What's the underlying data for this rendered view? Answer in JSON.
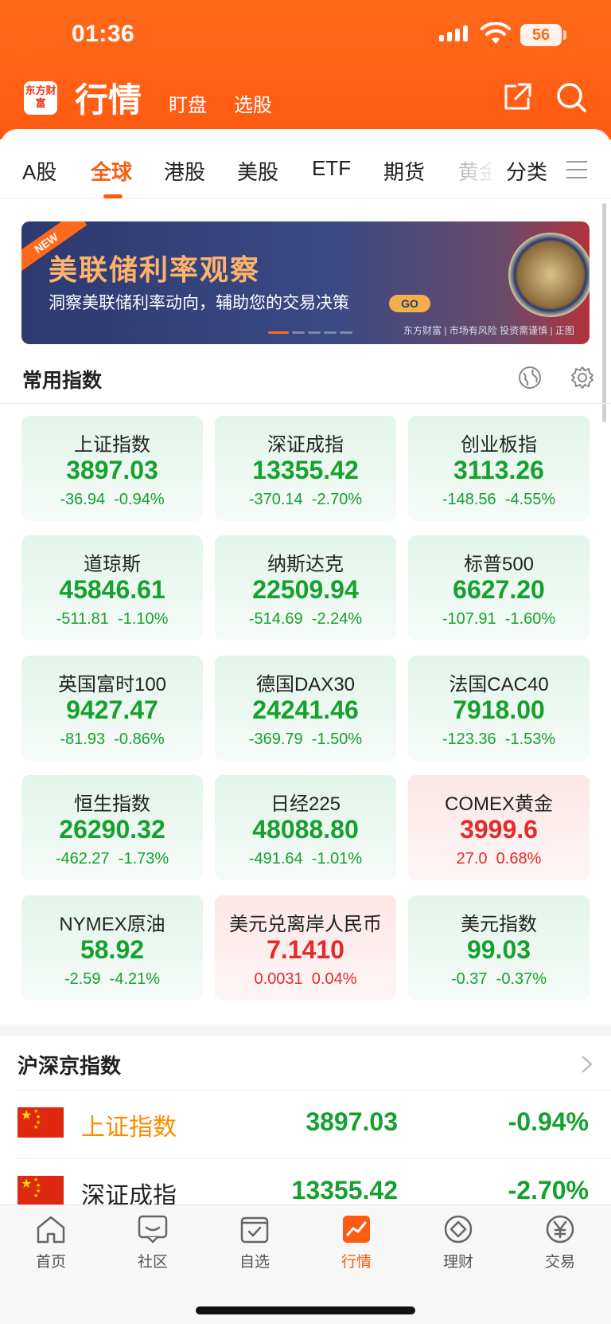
{
  "status_bar": {
    "time": "01:36",
    "battery": "56"
  },
  "header": {
    "logo": "东方财富",
    "title": "行情",
    "sub_nav": [
      "盯盘",
      "选股"
    ],
    "icons": [
      "share-icon",
      "search-icon"
    ]
  },
  "market_tabs": {
    "items": [
      "A股",
      "全球",
      "港股",
      "美股",
      "ETF",
      "期货",
      "黄金",
      "分类"
    ],
    "active": "全球",
    "menu_icon": "menu-icon"
  },
  "banner": {
    "badge": "NEW",
    "title": "美联储利率观察",
    "subtitle": "洞察美联储利率动向，辅助您的交易决策",
    "go_label": "GO",
    "disclaimer": "东方财富 | 市场有风险 投资需谨慎 | 正图"
  },
  "common_indices": {
    "title": "常用指数",
    "icons": [
      "global-map-icon",
      "settings-icon"
    ],
    "cards": [
      {
        "name": "上证指数",
        "price": "3897.03",
        "change": "-36.94",
        "pct": "-0.94%",
        "trend": "down"
      },
      {
        "name": "深证成指",
        "price": "13355.42",
        "change": "-370.14",
        "pct": "-2.70%",
        "trend": "down"
      },
      {
        "name": "创业板指",
        "price": "3113.26",
        "change": "-148.56",
        "pct": "-4.55%",
        "trend": "down"
      },
      {
        "name": "道琼斯",
        "price": "45846.61",
        "change": "-511.81",
        "pct": "-1.10%",
        "trend": "down"
      },
      {
        "name": "纳斯达克",
        "price": "22509.94",
        "change": "-514.69",
        "pct": "-2.24%",
        "trend": "down"
      },
      {
        "name": "标普500",
        "price": "6627.20",
        "change": "-107.91",
        "pct": "-1.60%",
        "trend": "down"
      },
      {
        "name": "英国富时100",
        "price": "9427.47",
        "change": "-81.93",
        "pct": "-0.86%",
        "trend": "down"
      },
      {
        "name": "德国DAX30",
        "price": "24241.46",
        "change": "-369.79",
        "pct": "-1.50%",
        "trend": "down"
      },
      {
        "name": "法国CAC40",
        "price": "7918.00",
        "change": "-123.36",
        "pct": "-1.53%",
        "trend": "down"
      },
      {
        "name": "恒生指数",
        "price": "26290.32",
        "change": "-462.27",
        "pct": "-1.73%",
        "trend": "down"
      },
      {
        "name": "日经225",
        "price": "48088.80",
        "change": "-491.64",
        "pct": "-1.01%",
        "trend": "down"
      },
      {
        "name": "COMEX黄金",
        "price": "3999.6",
        "change": "27.0",
        "pct": "0.68%",
        "trend": "up"
      },
      {
        "name": "NYMEX原油",
        "price": "58.92",
        "change": "-2.59",
        "pct": "-4.21%",
        "trend": "down"
      },
      {
        "name": "美元兑离岸人民币",
        "price": "7.1410",
        "change": "0.0031",
        "pct": "0.04%",
        "trend": "up"
      },
      {
        "name": "美元指数",
        "price": "99.03",
        "change": "-0.37",
        "pct": "-0.37%",
        "trend": "down"
      }
    ]
  },
  "index_list": {
    "title": "沪深京指数",
    "rows": [
      {
        "name": "上证指数",
        "price": "3897.03",
        "pct": "-0.94%",
        "name_color": "#ff8a00"
      },
      {
        "name": "深证成指",
        "price": "13355.42",
        "pct": "-2.70%",
        "name_color": "#222222"
      }
    ]
  },
  "bottom_nav": {
    "items": [
      {
        "label": "首页",
        "icon": "home-icon"
      },
      {
        "label": "社区",
        "icon": "chat-icon"
      },
      {
        "label": "自选",
        "icon": "checklist-icon"
      },
      {
        "label": "行情",
        "icon": "chart-icon"
      },
      {
        "label": "理财",
        "icon": "diamond-icon"
      },
      {
        "label": "交易",
        "icon": "yen-icon"
      }
    ],
    "active": "行情"
  },
  "colors": {
    "brand": "#ff5a12",
    "down": "#16a02e",
    "up": "#e42a2a"
  }
}
